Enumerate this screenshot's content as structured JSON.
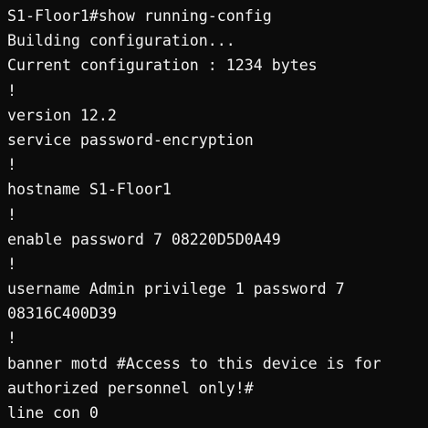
{
  "terminal": {
    "lines": [
      "S1-Floor1#show running-config",
      "Building configuration...",
      "Current configuration : 1234 bytes",
      "!",
      "version 12.2",
      "service password-encryption",
      "!",
      "hostname S1-Floor1",
      "!",
      "enable password 7 08220D5D0A49",
      "!",
      "username Admin privilege 1 password 7",
      "08316C400D39",
      "!",
      "banner motd #Access to this device is for",
      "authorized personnel only!#",
      "line con 0"
    ]
  },
  "colors": {
    "background": "#0c0c0c",
    "text": "#f2f2f2"
  }
}
